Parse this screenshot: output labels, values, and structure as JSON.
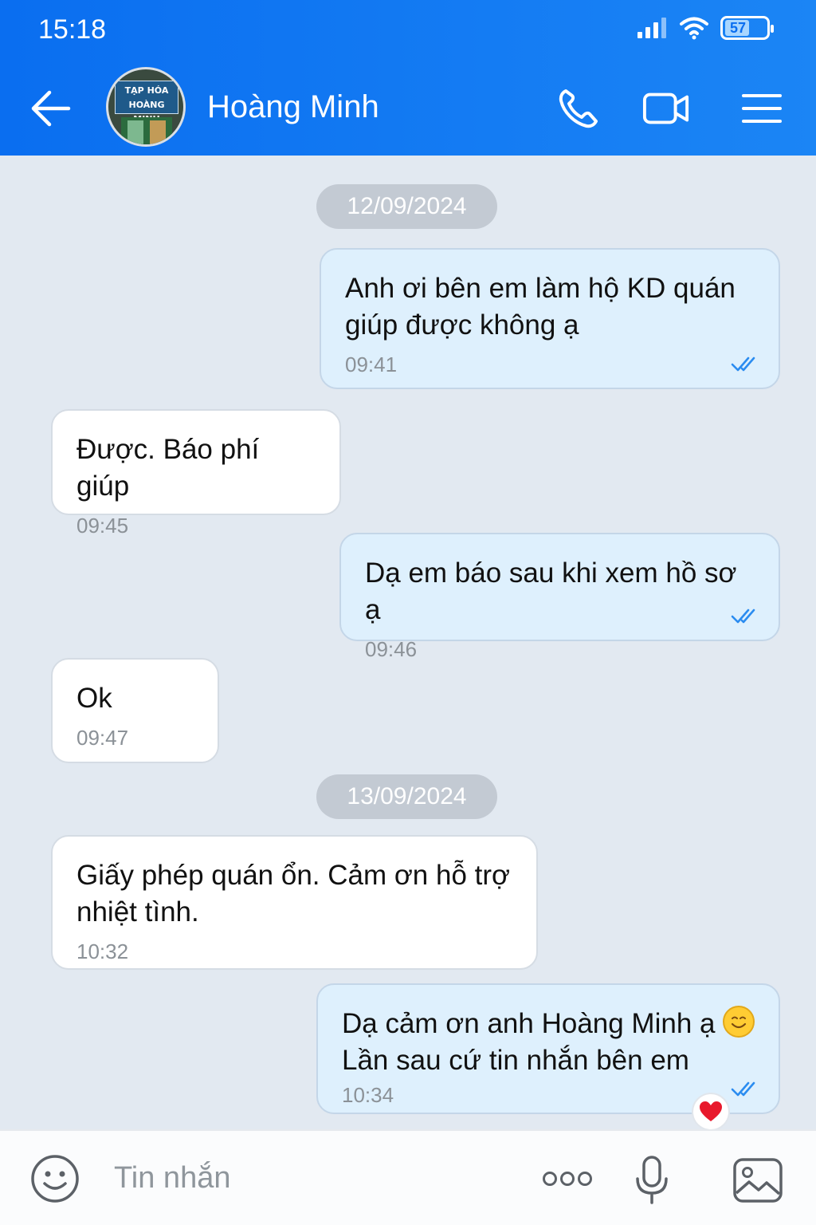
{
  "status": {
    "time": "15:18",
    "battery": "57"
  },
  "header": {
    "contact_name": "Hoàng Minh",
    "avatar_sign": "TẠP HÓA\nHOÀNG MINH"
  },
  "messages": [
    {
      "type": "date",
      "text": "12/09/2024"
    },
    {
      "type": "out",
      "text": "Anh ơi bên em làm hộ KD quán\ngiúp được không ạ",
      "time": "09:41"
    },
    {
      "type": "in",
      "text": "Được. Báo phí giúp",
      "time": "09:45"
    },
    {
      "type": "out",
      "text": "Dạ em báo sau khi xem hồ sơ ạ",
      "time": "09:46"
    },
    {
      "type": "in",
      "text": "Ok",
      "time": "09:47"
    },
    {
      "type": "date",
      "text": "13/09/2024"
    },
    {
      "type": "in",
      "text": "Giấy phép quán ổn. Cảm ơn hỗ trợ\nnhiệt tình.",
      "time": "10:32"
    },
    {
      "type": "out",
      "text_line1": "Dạ cảm ơn anh Hoàng Minh ạ",
      "text_line2": "Lần sau cứ tin nhắn bên em",
      "time": "10:34",
      "reaction": "heart"
    }
  ],
  "input": {
    "placeholder": "Tin nhắn"
  },
  "colors": {
    "header": "#0a6ef0",
    "outgoing_bubble": "#def0fd",
    "incoming_bubble": "#ffffff",
    "background": "#e2e9f1",
    "ticks": "#2b8cf0"
  }
}
